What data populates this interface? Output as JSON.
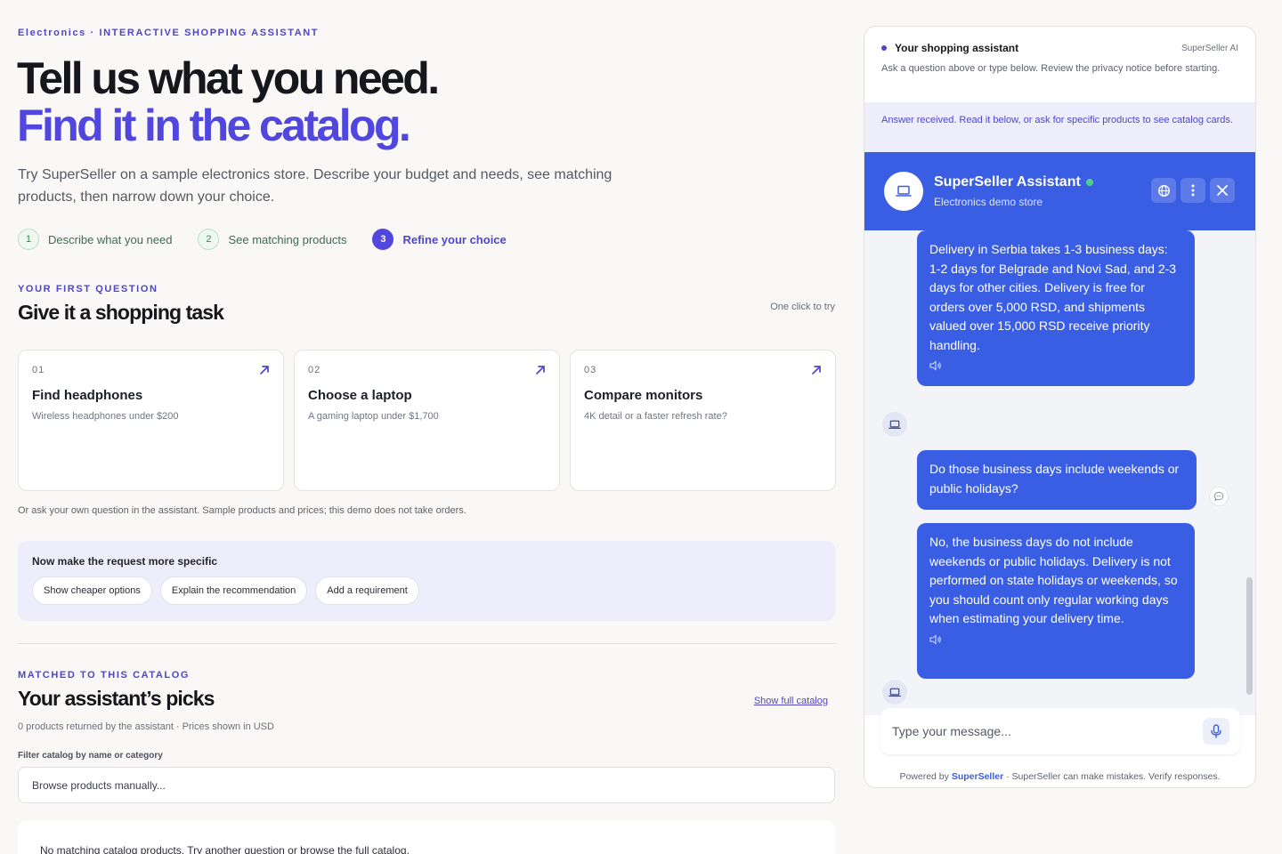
{
  "hero": {
    "eyebrow": "Electronics · INTERACTIVE SHOPPING ASSISTANT",
    "title_line1": "Tell us what you need.",
    "title_line2": "Find it in the catalog.",
    "intro": "Try SuperSeller on a sample electronics store. Describe your budget and needs, see matching products, then narrow down your choice."
  },
  "steps": [
    {
      "num": "1",
      "label": "Describe what you need"
    },
    {
      "num": "2",
      "label": "See matching products"
    },
    {
      "num": "3",
      "label": "Refine your choice"
    }
  ],
  "tasks": {
    "eyebrow": "YOUR FIRST QUESTION",
    "title": "Give it a shopping task",
    "hint": "One click to try",
    "cards": [
      {
        "num": "01",
        "title": "Find headphones",
        "desc": "Wireless headphones under $200"
      },
      {
        "num": "02",
        "title": "Choose a laptop",
        "desc": "A gaming laptop under $1,700"
      },
      {
        "num": "03",
        "title": "Compare monitors",
        "desc": "4K detail or a faster refresh rate?"
      }
    ],
    "note": "Or ask your own question in the assistant. Sample products and prices; this demo does not take orders."
  },
  "refine": {
    "title": "Now make the request more specific",
    "chips": [
      "Show cheaper options",
      "Explain the recommendation",
      "Add a requirement"
    ]
  },
  "picks": {
    "eyebrow": "MATCHED TO THIS CATALOG",
    "title": "Your assistant’s picks",
    "link": "Show full catalog",
    "sub": "0 products returned by the assistant · Prices shown in USD",
    "filter_label": "Filter catalog by name or category",
    "filter_placeholder": "Browse products manually...",
    "empty": "No matching catalog products. Try another question or browse the full catalog."
  },
  "panel": {
    "title": "Your shopping assistant",
    "brand": "SuperSeller AI",
    "desc": "Ask a question above or type below. Review the privacy notice before starting.",
    "status": "Answer received. Read it below, or ask for specific products to see catalog cards."
  },
  "chat": {
    "name": "SuperSeller Assistant",
    "store": "Electronics demo store",
    "messages": [
      {
        "from": "bot",
        "text": "Delivery in Serbia takes 1-3 business days: 1-2 days for Belgrade and Novi Sad, and 2-3 days for other cities. Delivery is free for orders over 5,000 RSD, and shipments valued over 15,000 RSD receive priority handling."
      },
      {
        "from": "user",
        "text": "Do those business days include weekends or public holidays?"
      },
      {
        "from": "bot",
        "text": "No, the business days do not include weekends or public holidays. Delivery is not performed on state holidays or weekends, so you should count only regular working days when estimating your delivery time."
      }
    ],
    "input_placeholder": "Type your message...",
    "footer_prefix": "Powered by",
    "footer_brand": "SuperSeller",
    "footer_suffix": "· SuperSeller can make mistakes. Verify responses."
  }
}
